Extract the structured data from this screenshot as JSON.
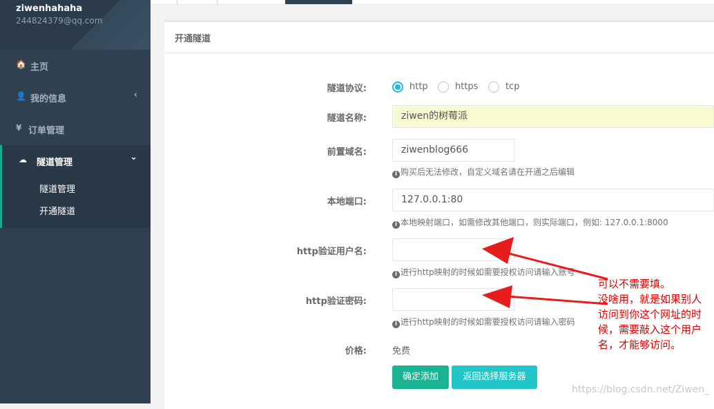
{
  "sidebar": {
    "username": "ziwenhahaha",
    "email": "244824379@qq.com",
    "items": [
      {
        "icon": "home-icon",
        "glyph": "🏠",
        "label": "主页"
      },
      {
        "icon": "user-icon",
        "glyph": "👤",
        "label": "我的信息",
        "chevron": "‹"
      },
      {
        "icon": "yen-icon",
        "glyph": "¥",
        "label": "订单管理"
      },
      {
        "icon": "cloud-icon",
        "glyph": "☁",
        "label": "隧道管理",
        "chevron": "⌄"
      }
    ],
    "subitems": [
      "隧道管理",
      "开通隧道"
    ]
  },
  "panel": {
    "title": "开通隧道",
    "protocol_label": "隧道协议:",
    "protocol_options": [
      "http",
      "https",
      "tcp"
    ],
    "protocol_selected": "http",
    "name_label": "隧道名称:",
    "name_value": "ziwen的树莓派",
    "domain_label": "前置域名:",
    "domain_value": "ziwenblog666",
    "domain_help": "购买后无法修改，自定义域名请在开通之后编辑",
    "port_label": "本地端口:",
    "port_value": "127.0.0.1:80",
    "port_help": "本地映射端口，如需修改其他端口，则实际端口，例如:  127.0.0.1:8000",
    "user_label": "http验证用户名:",
    "user_value": "",
    "user_help": "进行http映射的时候如需要授权访问请输入账号",
    "pass_label": "http验证密码:",
    "pass_value": "",
    "pass_help": "进行http映射的时候如需要授权访问请输入密码",
    "price_label": "价格:",
    "price_value": "免费",
    "confirm_button": "确定添加",
    "back_button": "返回选择服务器"
  },
  "annotation": {
    "lines": [
      "可以不需要填。",
      "没啥用，就是如果别人",
      "访问到你这个网址的时",
      "候，需要敲入这个用户",
      "名，才能够访问。"
    ],
    "color": "#e00000"
  },
  "watermark": "https://blog.csdn.net/Ziwen_",
  "colors": {
    "sidebar": "#2f4050",
    "accent": "#1ab394",
    "info": "#23c6c8",
    "radio": "#23b7e5"
  }
}
